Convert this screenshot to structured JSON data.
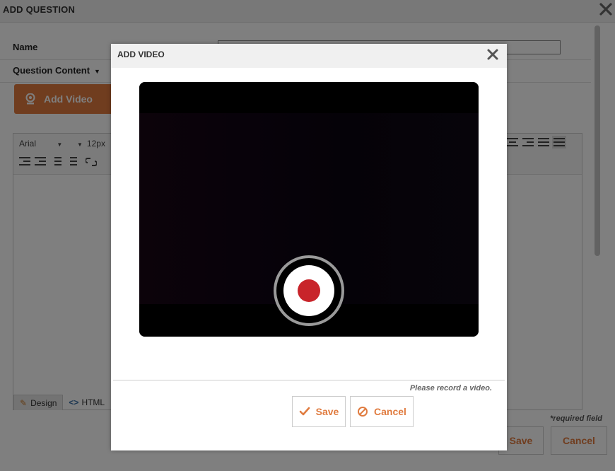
{
  "background_dialog": {
    "title": "ADD QUESTION",
    "name_label": "Name",
    "content_label": "Question Content",
    "add_video_label": "Add Video",
    "editor": {
      "font": "Arial",
      "size": "12px",
      "tabs": [
        "Design",
        "HTML"
      ]
    },
    "required_note": "*required field",
    "save_label": "Save",
    "cancel_label": "Cancel"
  },
  "modal": {
    "title": "ADD VIDEO",
    "hint": "Please record a video.",
    "save_label": "Save",
    "cancel_label": "Cancel"
  },
  "colors": {
    "accent": "#e07b3f",
    "record": "#c8242a"
  },
  "icons": [
    "close-icon",
    "webcam-icon",
    "checkmark-icon",
    "cancel-icon",
    "record-icon",
    "pencil-icon",
    "code-icon"
  ]
}
